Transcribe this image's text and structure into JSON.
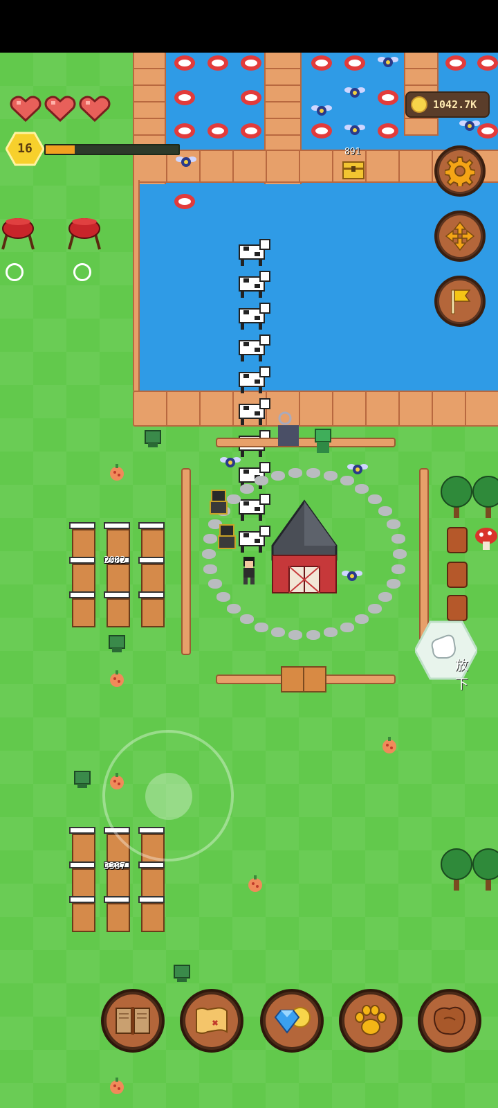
{
  "hud": {
    "hearts": 3,
    "level": "16",
    "xp_progress": 0.22,
    "coins": "1042.7K"
  },
  "map_labels": {
    "dock_counter": "891",
    "hive_group_1_count": "2082",
    "hive_group_2_count": "3387"
  },
  "side_buttons": [
    {
      "icon": "gear-icon"
    },
    {
      "icon": "move-arrows-icon"
    },
    {
      "icon": "flag-icon"
    }
  ],
  "drop_button": {
    "label": "放下",
    "icon": "hand-icon"
  },
  "bottom_bar": [
    {
      "icon": "book-icon"
    },
    {
      "icon": "treasure-map-icon"
    },
    {
      "icon": "diamond-coin-shop-icon"
    },
    {
      "icon": "paw-icon"
    },
    {
      "icon": "leather-hide-icon"
    }
  ],
  "colors": {
    "grass": "#62c94c",
    "water": "#2f9be6",
    "wood": "#e7a06a",
    "button_brown": "#b4663a",
    "xp_fill": "#f2a020",
    "level_badge": "#f7d02c"
  }
}
